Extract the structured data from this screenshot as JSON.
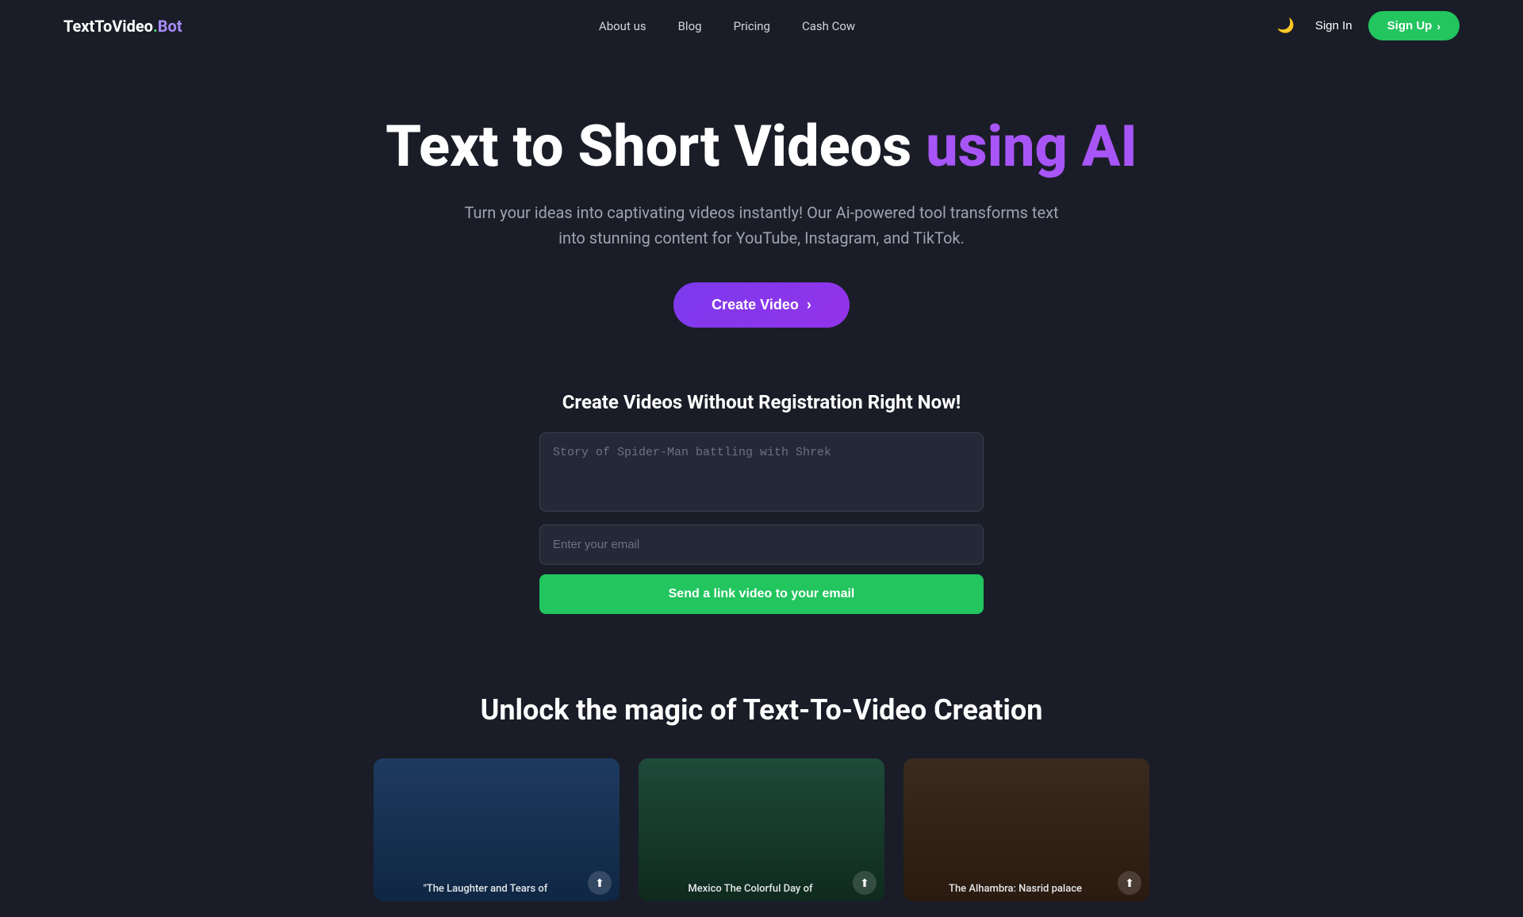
{
  "logo": {
    "text_prefix": "TextToVideo",
    "dot": ".",
    "text_suffix": "Bot"
  },
  "navbar": {
    "links": [
      {
        "label": "About us",
        "href": "#"
      },
      {
        "label": "Blog",
        "href": "#"
      },
      {
        "label": "Pricing",
        "href": "#"
      },
      {
        "label": "Cash Cow",
        "href": "#"
      }
    ],
    "sign_in": "Sign In",
    "sign_up": "Sign Up"
  },
  "hero": {
    "title_part1": "Text to Short Videos ",
    "title_highlight": "using AI",
    "subtitle": "Turn your ideas into captivating videos instantly! Our Ai-powered tool transforms text into stunning content for YouTube, Instagram, and TikTok.",
    "cta_button": "Create Video"
  },
  "form_section": {
    "title": "Create Videos Without Registration Right Now!",
    "story_placeholder": "Story of Spider-Man battling with Shrek",
    "email_placeholder": "Enter your email",
    "submit_button": "Send a link video to your email"
  },
  "unlock_section": {
    "title": "Unlock the magic of Text-To-Video Creation",
    "videos": [
      {
        "label": "\"The Laughter and Tears of"
      },
      {
        "label": "Mexico The Colorful Day of"
      },
      {
        "label": "The Alhambra: Nasrid palace"
      }
    ]
  },
  "icons": {
    "moon": "🌙",
    "chevron_right": "›",
    "share": "⬆"
  }
}
